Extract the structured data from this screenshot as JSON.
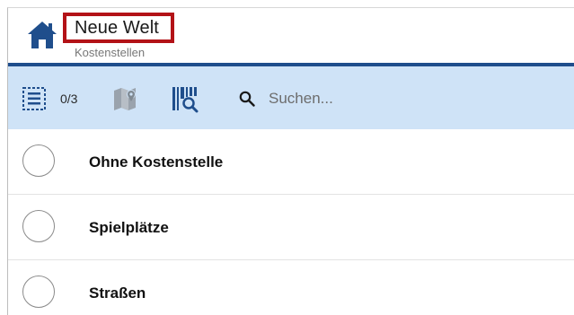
{
  "header": {
    "title": "Neue Welt",
    "subtitle": "Kostenstellen",
    "home_icon": "home-icon",
    "accent_color": "#1f4e8c",
    "highlight_color": "#b31217"
  },
  "toolbar": {
    "background": "#cfe3f7",
    "selection_count": "0/3",
    "icons": [
      "list-select-icon",
      "map-pin-icon",
      "barcode-search-icon",
      "search-icon"
    ],
    "search_placeholder": "Suchen..."
  },
  "list": {
    "items": [
      {
        "label": "Ohne Kostenstelle",
        "selected": false
      },
      {
        "label": "Spielplätze",
        "selected": false
      },
      {
        "label": "Straßen",
        "selected": false
      }
    ]
  }
}
